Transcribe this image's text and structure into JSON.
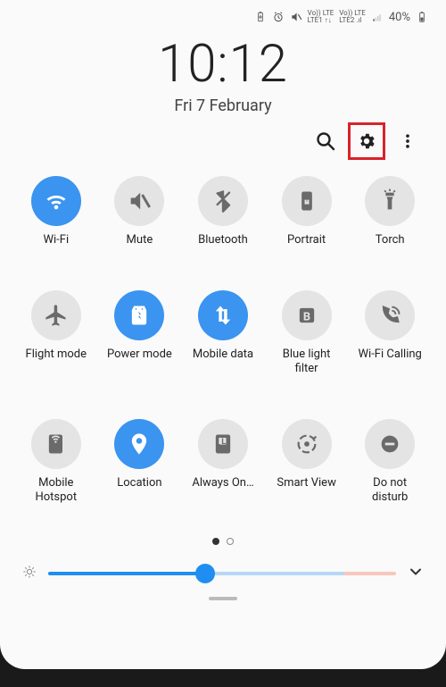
{
  "statusbar": {
    "net1_label": "Vo)) LTE\nLTE1 ↑↓",
    "net2_label": "Vo)) LTE\nLTE2 .ıl",
    "battery_pct": "40%"
  },
  "clock": {
    "time": "10:12",
    "date": "Fri 7 February"
  },
  "tiles": [
    {
      "key": "wifi",
      "label": "Wi-Fi",
      "active": true
    },
    {
      "key": "mute",
      "label": "Mute",
      "active": false
    },
    {
      "key": "bluetooth",
      "label": "Bluetooth",
      "active": false
    },
    {
      "key": "portrait",
      "label": "Portrait",
      "active": false
    },
    {
      "key": "torch",
      "label": "Torch",
      "active": false
    },
    {
      "key": "flight",
      "label": "Flight mode",
      "active": false
    },
    {
      "key": "power",
      "label": "Power mode",
      "active": true
    },
    {
      "key": "mobiledata",
      "label": "Mobile data",
      "active": true
    },
    {
      "key": "bluelight",
      "label": "Blue light filter",
      "active": false
    },
    {
      "key": "wificall",
      "label": "Wi-Fi Calling",
      "active": false
    },
    {
      "key": "hotspot",
      "label": "Mobile Hotspot",
      "active": false
    },
    {
      "key": "location",
      "label": "Location",
      "active": true
    },
    {
      "key": "always",
      "label": "Always On…",
      "active": false
    },
    {
      "key": "smartview",
      "label": "Smart View",
      "active": false
    },
    {
      "key": "dnd",
      "label": "Do not disturb",
      "active": false
    }
  ],
  "pager": {
    "current": 0,
    "total": 2
  },
  "brightness_pct": 45
}
